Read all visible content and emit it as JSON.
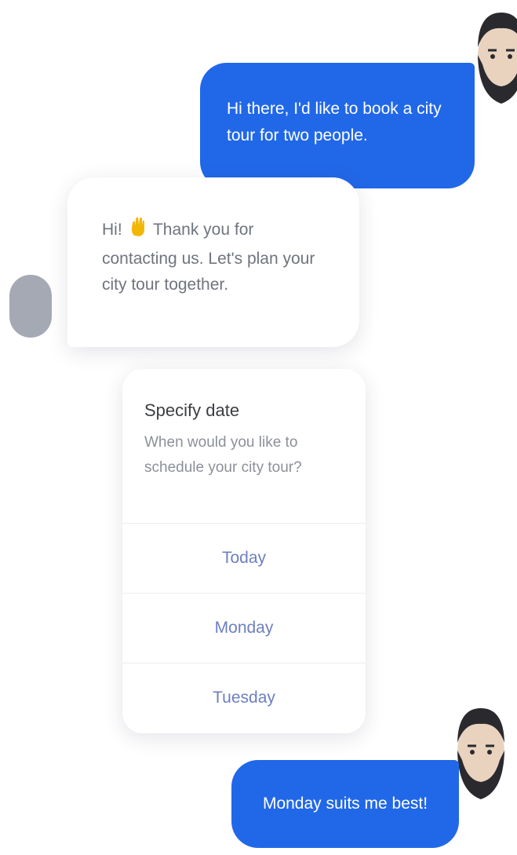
{
  "messages": {
    "user_first": "Hi there, I'd like to book a city tour for two people.",
    "bot_greeting_pre": "Hi!",
    "bot_greeting_post": "Thank you for contacting us. Let's plan your city tour together.",
    "user_reply": "Monday suits me best!"
  },
  "date_card": {
    "title": "Specify date",
    "subtitle": "When would you like to schedule your city tour?",
    "options": [
      "Today",
      "Monday",
      "Tuesday"
    ]
  },
  "colors": {
    "user_bubble": "#2168e8",
    "bot_avatar": "#a5a9b4",
    "option_text": "#6d7fbf"
  },
  "icons": {
    "user_avatar": "bearded-man-avatar",
    "greeting_emoji": "waving-hand-icon"
  }
}
